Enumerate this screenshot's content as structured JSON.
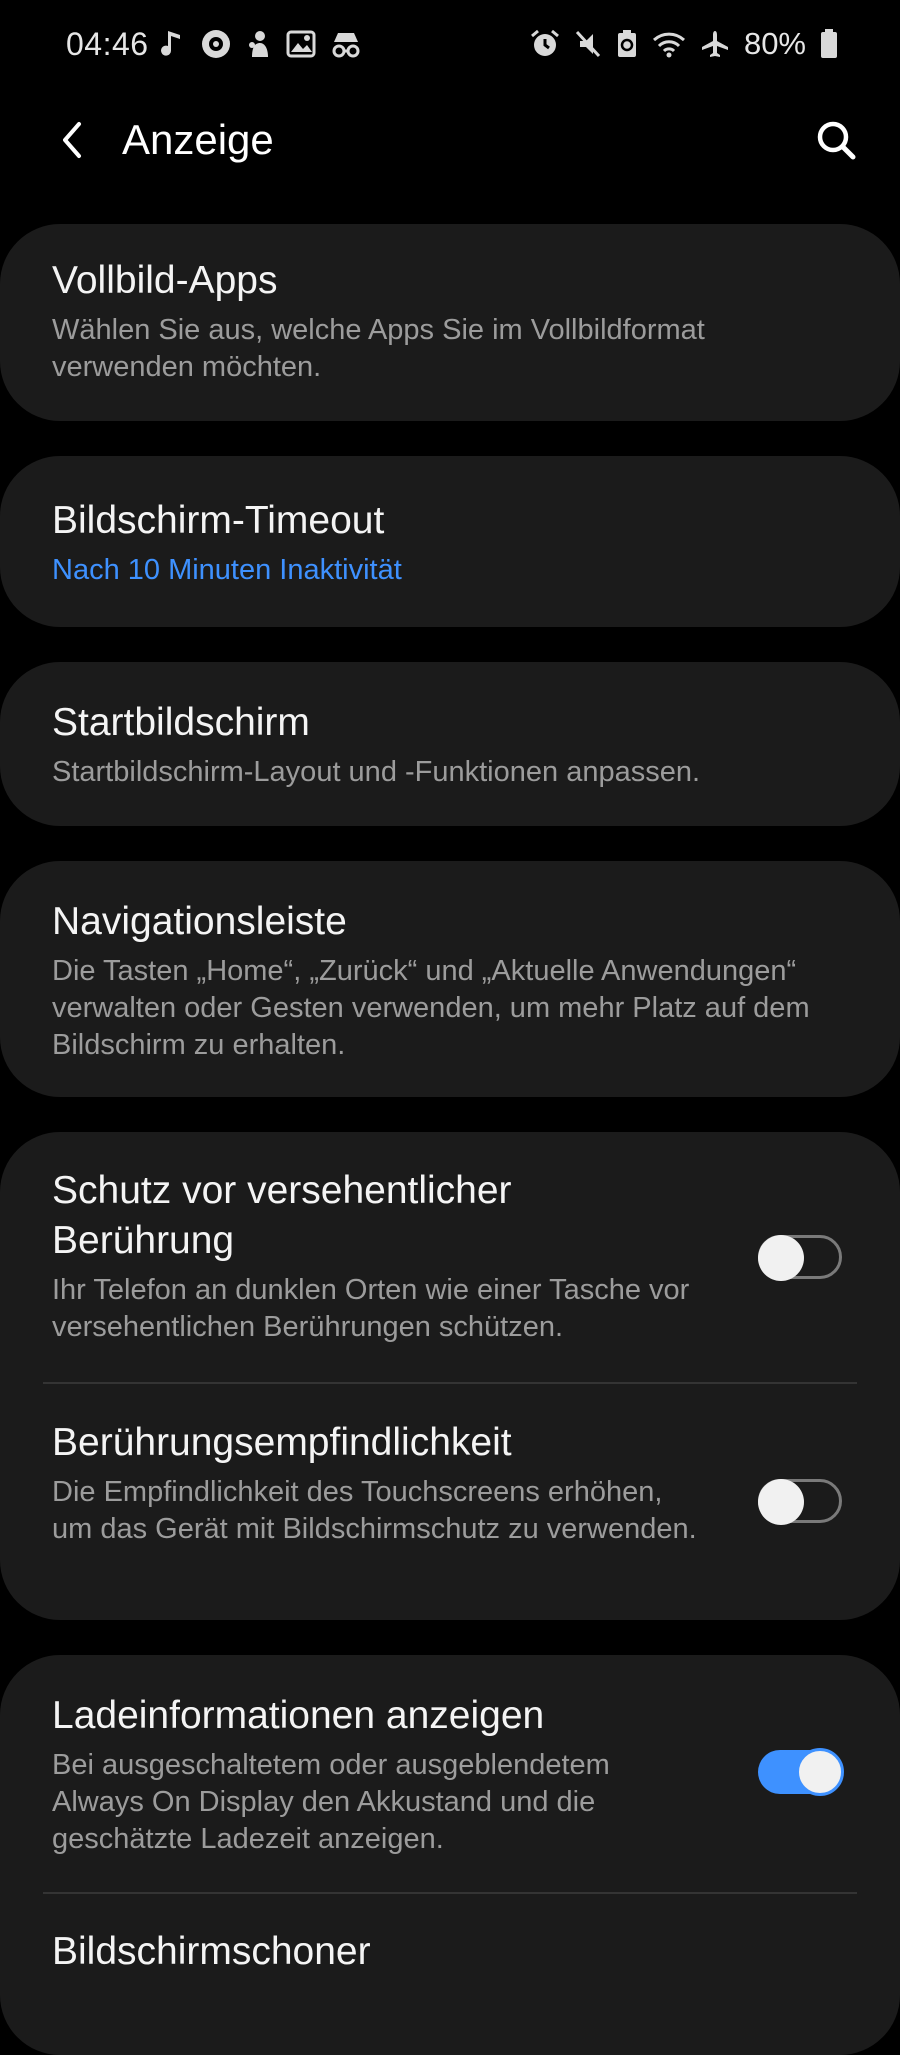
{
  "status_bar": {
    "time": "04:46",
    "left_icons": [
      "music-note-icon",
      "record-icon",
      "notification-icon",
      "image-icon",
      "incognito-icon"
    ],
    "right_icons": [
      "alarm-icon",
      "mute-icon",
      "battery-saver-icon",
      "wifi-icon",
      "airplane-icon"
    ],
    "battery_percent": "80%"
  },
  "app_bar": {
    "title": "Anzeige",
    "back_icon": "back-arrow-icon",
    "search_icon": "search-icon"
  },
  "colors": {
    "background": "#000000",
    "card": "#1b1b1b",
    "accent": "#3e91ff",
    "subtext": "#9c9c9c"
  },
  "settings": {
    "fullscreen_apps": {
      "title": "Vollbild-Apps",
      "subtitle": "Wählen Sie aus, welche Apps Sie im Vollbildformat verwenden möchten."
    },
    "screen_timeout": {
      "title": "Bildschirm-Timeout",
      "subtitle": "Nach 10 Minuten Inaktivität"
    },
    "home_screen": {
      "title": "Startbildschirm",
      "subtitle": "Startbildschirm-Layout und -Funktionen anpassen."
    },
    "navigation_bar": {
      "title": "Navigationsleiste",
      "subtitle": "Die Tasten „Home“, „Zurück“ und „Aktuelle Anwendungen“ verwalten oder Gesten verwenden, um mehr Platz auf dem Bildschirm zu erhalten."
    },
    "accidental_touch": {
      "title": "Schutz vor versehentlicher Berührung",
      "subtitle": "Ihr Telefon an dunklen Orten wie einer Tasche vor versehentlichen Berührungen schützen.",
      "enabled": false
    },
    "touch_sensitivity": {
      "title": "Berührungsempfindlichkeit",
      "subtitle": "Die Empfindlichkeit des Touchscreens erhöhen, um das Gerät mit Bildschirmschutz zu verwenden.",
      "enabled": false
    },
    "charging_info": {
      "title": "Ladeinformationen anzeigen",
      "subtitle": "Bei ausgeschaltetem oder ausgeblendetem Always On Display den Akkustand und die geschätzte Ladezeit anzeigen.",
      "enabled": true
    },
    "screen_saver": {
      "title": "Bildschirmschoner"
    }
  }
}
